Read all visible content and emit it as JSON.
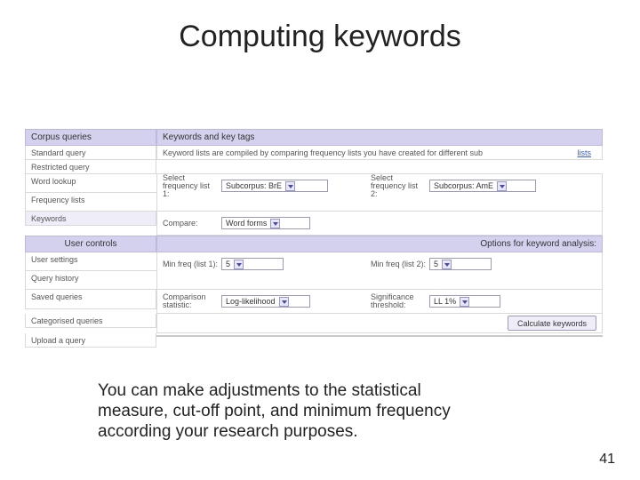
{
  "title": "Computing keywords",
  "page_number": "41",
  "caption": "You can make adjustments to the statistical measure, cut-off point, and minimum frequency according your research purposes.",
  "sidebar": {
    "header1": "Corpus queries",
    "items1": [
      "Standard query",
      "Restricted query",
      "Word lookup",
      "Frequency lists",
      "Keywords"
    ],
    "header2": "User controls",
    "items2": [
      "User settings",
      "Query history",
      "Saved queries",
      "Categorised queries",
      "Upload a query"
    ]
  },
  "panel": {
    "header1": "Keywords and key tags",
    "intro": "Keyword lists are compiled by comparing frequency lists you have created for different sub",
    "intro_link": "lists",
    "list1_label": "Select frequency list 1:",
    "list1_value": "Subcorpus: BrE",
    "list2_label": "Select frequency list 2:",
    "list2_value": "Subcorpus: AmE",
    "compare_label": "Compare:",
    "compare_value": "Word forms",
    "header2": "Options for keyword analysis:",
    "min1_label": "Min freq (list 1):",
    "min1_value": "5",
    "min2_label": "Min freq (list 2):",
    "min2_value": "5",
    "stat_label": "Comparison statistic:",
    "stat_value": "Log-likelihood",
    "sig_label": "Significance threshold:",
    "sig_value": "LL 1%",
    "submit": "Calculate keywords"
  }
}
